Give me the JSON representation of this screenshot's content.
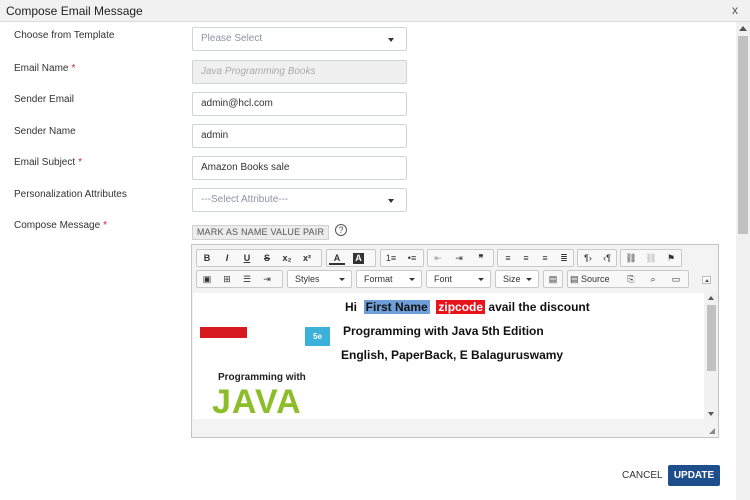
{
  "dialog": {
    "title": "Compose Email Message",
    "close": "x"
  },
  "form": {
    "template": {
      "label": "Choose from Template",
      "placeholder": "Please Select"
    },
    "email_name": {
      "label": "Email Name",
      "required": "*",
      "value": "Java Programming Books"
    },
    "sender_email": {
      "label": "Sender Email",
      "value": "admin@hcl.com"
    },
    "sender_name": {
      "label": "Sender Name",
      "value": "admin"
    },
    "email_subject": {
      "label": "Email Subject",
      "required": "*",
      "value": "Amazon Books sale"
    },
    "personalization": {
      "label": "Personalization Attributes",
      "placeholder": "---Select Attribute---"
    },
    "compose": {
      "label": "Compose Message",
      "required": "*"
    }
  },
  "mark_button": "MARK AS NAME VALUE PAIR",
  "help": "?",
  "toolbar": {
    "bold": "B",
    "italic": "I",
    "underline": "U",
    "strike": "S",
    "subscript": "x₂",
    "superscript": "x²",
    "text_color": "A",
    "bg_color": "A",
    "numbered": "1≡",
    "bulleted": "•≡",
    "outdent": "⇤",
    "indent": "⇥",
    "blockquote": "❞",
    "ltr": "¶›",
    "rtl": "‹¶",
    "link": "⛓",
    "unlink": "⛓",
    "anchor": "⚑",
    "styles": "Styles",
    "format": "Format",
    "font": "Font",
    "size": "Size",
    "source": "Source"
  },
  "message": {
    "line1_prefix": "Hi",
    "token_first_name": "First Name",
    "token_zipcode": "zipcode",
    "line1_suffix": "avail the discount",
    "line2": "Programming with Java 5th Edition",
    "line3": "English, PaperBack, E Balaguruswamy",
    "book": {
      "edition": "5e",
      "title_top": "Programming with",
      "title_big": "JAVA"
    }
  },
  "footer": {
    "cancel": "CANCEL",
    "update": "UPDATE"
  },
  "colors": {
    "primary": "#1f4e8c",
    "token_blue": "#6f9fd8",
    "token_red": "#e8141b",
    "required": "#c62828"
  }
}
